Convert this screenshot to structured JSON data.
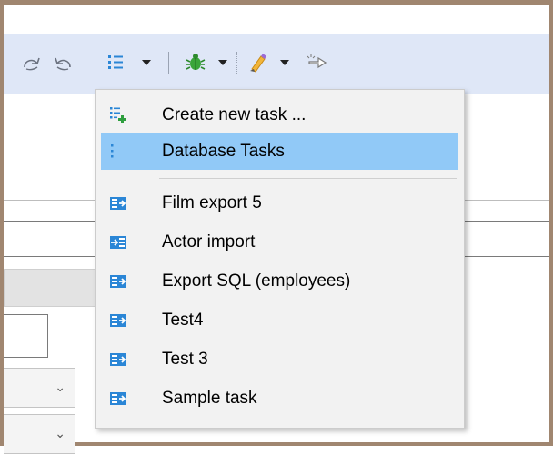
{
  "toolbar": {
    "icons": [
      "redo-icon",
      "undo-icon",
      "task-list-icon",
      "debug-bug-icon",
      "brush-icon",
      "pointer-hand-icon"
    ],
    "accent": "#2b86d6"
  },
  "menu": {
    "items": [
      {
        "label": "Create new task ...",
        "icon": "new-task-icon"
      },
      {
        "label": "Database Tasks",
        "icon": "task-list-icon",
        "active": true
      },
      {
        "label": "Film export 5",
        "icon": "export-task-icon"
      },
      {
        "label": "Actor import",
        "icon": "import-task-icon"
      },
      {
        "label": "Export SQL (employees)",
        "icon": "export-task-icon"
      },
      {
        "label": "Test4",
        "icon": "export-task-icon"
      },
      {
        "label": "Test 3",
        "icon": "export-task-icon"
      },
      {
        "label": "Sample task",
        "icon": "export-task-icon"
      }
    ],
    "highlight_color": "#91c9f7"
  }
}
